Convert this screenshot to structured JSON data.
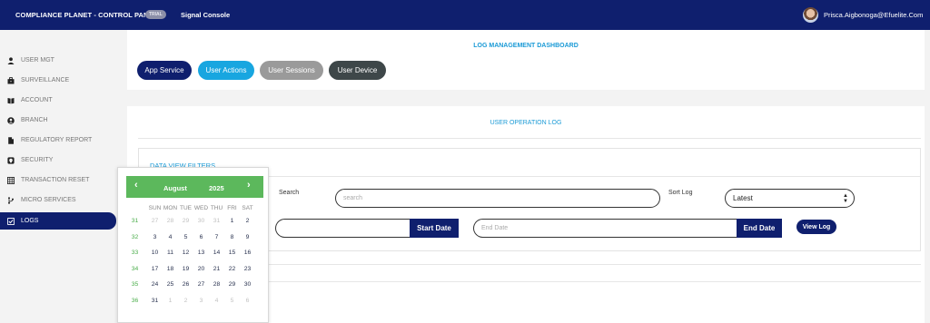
{
  "topbar": {
    "brand": "COMPLIANCE PLANET - CONTROL PANEL",
    "badge": "TRIAL",
    "console": "Signal Console",
    "user_email": "Prisca.Aigbonoga@Efuelite.Com"
  },
  "sidebar": {
    "items": [
      {
        "label": "USER MGT",
        "icon": "user-icon"
      },
      {
        "label": "SURVEILLANCE",
        "icon": "briefcase-icon"
      },
      {
        "label": "ACCOUNT",
        "icon": "book-icon"
      },
      {
        "label": "BRANCH",
        "icon": "user-circle-icon"
      },
      {
        "label": "REGULATORY REPORT",
        "icon": "document-icon"
      },
      {
        "label": "SECURITY",
        "icon": "shield-icon"
      },
      {
        "label": "TRANSACTION RESET",
        "icon": "grid-icon"
      },
      {
        "label": "MICRO SERVICES",
        "icon": "branch-icon"
      },
      {
        "label": "LOGS",
        "icon": "checkbox-icon",
        "active": true
      }
    ]
  },
  "dashboard": {
    "title": "LOG MANAGEMENT DASHBOARD",
    "tabs": [
      {
        "label": "App Service",
        "color": "#0f1f6e"
      },
      {
        "label": "User Actions",
        "color": "#18a6e0"
      },
      {
        "label": "User Sessions",
        "color": "#9a9a9a"
      },
      {
        "label": "User Device",
        "color": "#3e4749"
      }
    ]
  },
  "log": {
    "title": "USER OPERATION LOG",
    "filters_title": "DATA VIEW FILTERS",
    "search_label": "Search",
    "search_placeholder": "search",
    "sort_label": "Sort Log",
    "sort_value": "Latest",
    "start_date_button": "Start Date",
    "end_date_placeholder": "End Date",
    "end_date_button": "End Date",
    "view_button": "View Log"
  },
  "calendar": {
    "month": "August",
    "year": "2025",
    "prev": "‹",
    "next": "›",
    "days_of_week": [
      "SUN",
      "MON",
      "TUE",
      "WED",
      "THU",
      "FRI",
      "SAT"
    ],
    "weeks": [
      {
        "week": "31",
        "days": [
          "27",
          "28",
          "29",
          "30",
          "31",
          "1",
          "2"
        ],
        "other": [
          true,
          true,
          true,
          true,
          true,
          false,
          false
        ]
      },
      {
        "week": "32",
        "days": [
          "3",
          "4",
          "5",
          "6",
          "7",
          "8",
          "9"
        ],
        "other": [
          false,
          false,
          false,
          false,
          false,
          false,
          false
        ]
      },
      {
        "week": "33",
        "days": [
          "10",
          "11",
          "12",
          "13",
          "14",
          "15",
          "16"
        ],
        "other": [
          false,
          false,
          false,
          false,
          false,
          false,
          false
        ]
      },
      {
        "week": "34",
        "days": [
          "17",
          "18",
          "19",
          "20",
          "21",
          "22",
          "23"
        ],
        "other": [
          false,
          false,
          false,
          false,
          false,
          false,
          false
        ]
      },
      {
        "week": "35",
        "days": [
          "24",
          "25",
          "26",
          "27",
          "28",
          "29",
          "30"
        ],
        "other": [
          false,
          false,
          false,
          false,
          false,
          false,
          false
        ]
      },
      {
        "week": "36",
        "days": [
          "31",
          "1",
          "2",
          "3",
          "4",
          "5",
          "6"
        ],
        "other": [
          false,
          true,
          true,
          true,
          true,
          true,
          true
        ]
      }
    ]
  }
}
